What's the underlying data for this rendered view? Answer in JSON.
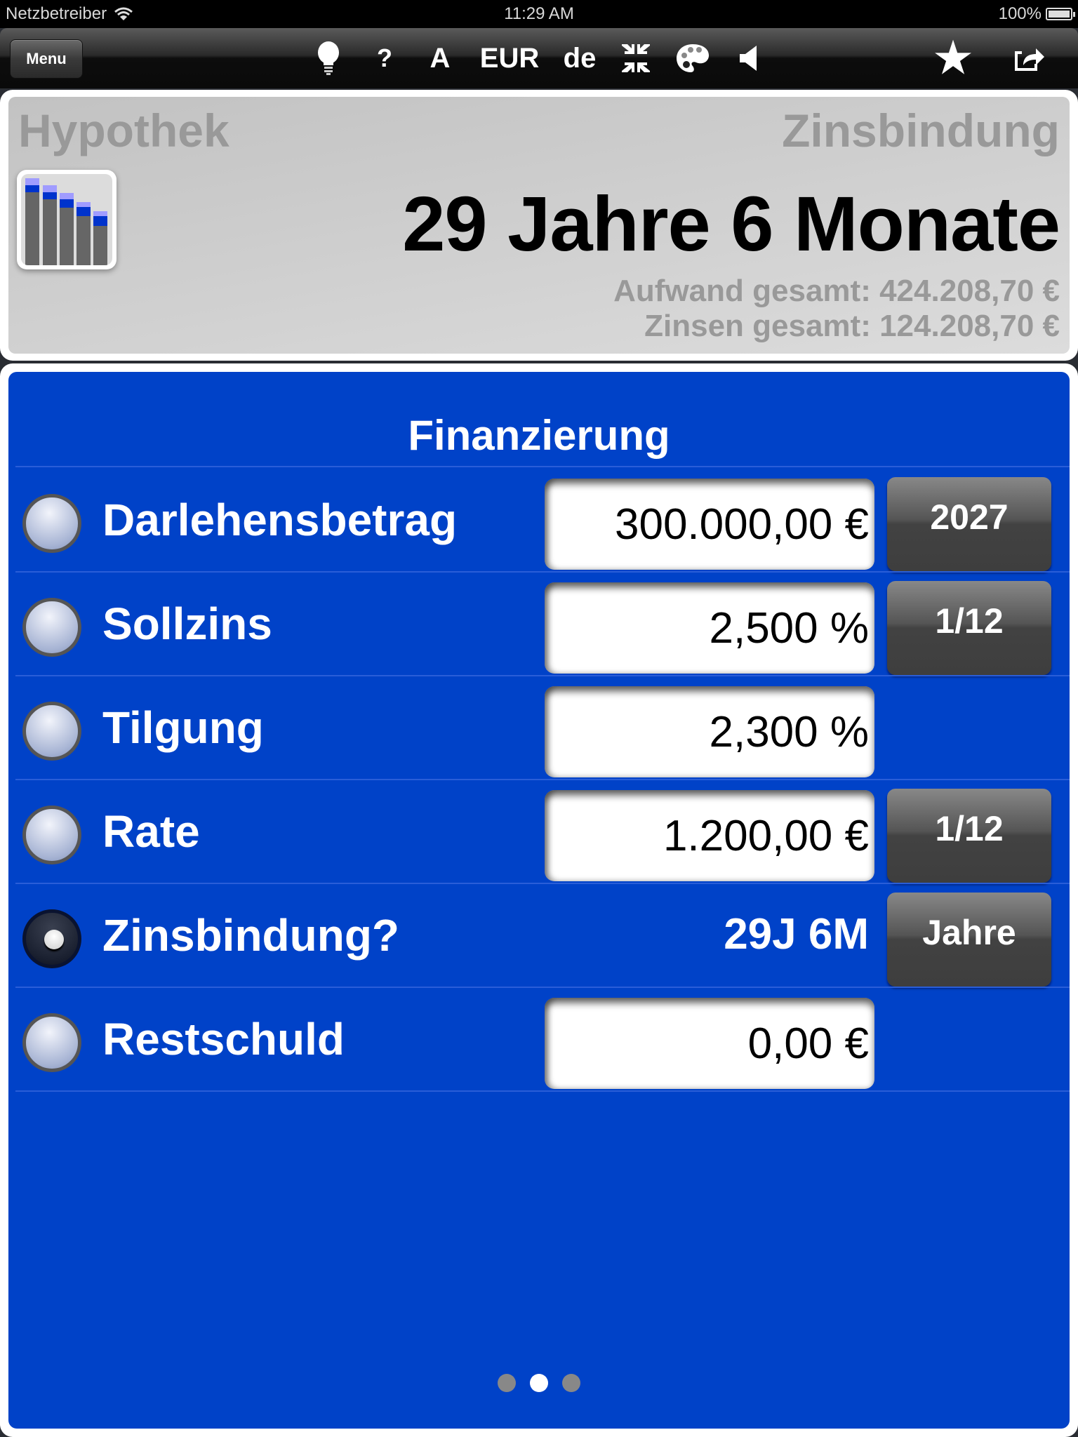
{
  "status_bar": {
    "carrier": "Netzbetreiber",
    "time": "11:29 AM",
    "battery": "100%"
  },
  "toolbar": {
    "menu_label": "Menu",
    "tools": [
      {
        "name": "lightbulb-icon",
        "glyph": ""
      },
      {
        "name": "help-button",
        "glyph": "?"
      },
      {
        "name": "font-button",
        "glyph": "A"
      },
      {
        "name": "currency-button",
        "glyph": "EUR"
      },
      {
        "name": "language-button",
        "glyph": "de"
      },
      {
        "name": "compress-icon",
        "glyph": ""
      },
      {
        "name": "palette-icon",
        "glyph": ""
      },
      {
        "name": "speaker-icon",
        "glyph": ""
      },
      {
        "name": "star-icon",
        "glyph": "★"
      },
      {
        "name": "share-icon",
        "glyph": ""
      }
    ]
  },
  "summary": {
    "app_title": "Hypothek",
    "result_title": "Zinsbindung",
    "result_value": "29 Jahre 6 Monate",
    "total_cost": "Aufwand gesamt: 424.208,70 €",
    "total_interest": "Zinsen gesamt: 124.208,70 €"
  },
  "main": {
    "section_title": "Finanzierung",
    "rows": [
      {
        "label": "Darlehensbetrag",
        "value": "300.000,00 €",
        "option": "2027",
        "selected": false,
        "type": "field"
      },
      {
        "label": "Sollzins",
        "value": "2,500 %",
        "option": "1/12",
        "selected": false,
        "type": "field"
      },
      {
        "label": "Tilgung",
        "value": "2,300 %",
        "option": null,
        "selected": false,
        "type": "field"
      },
      {
        "label": "Rate",
        "value": "1.200,00 €",
        "option": "1/12",
        "selected": false,
        "type": "field"
      },
      {
        "label": "Zinsbindung?",
        "value": "29J 6M",
        "option": "Jahre",
        "selected": true,
        "type": "readout"
      },
      {
        "label": "Restschuld",
        "value": "0,00 €",
        "option": null,
        "selected": false,
        "type": "field"
      }
    ],
    "pager": {
      "pages": 3,
      "current": 2
    }
  },
  "colors": {
    "panel_blue": "#0042c8",
    "button_dark": "#424242",
    "muted_text": "#999999"
  }
}
